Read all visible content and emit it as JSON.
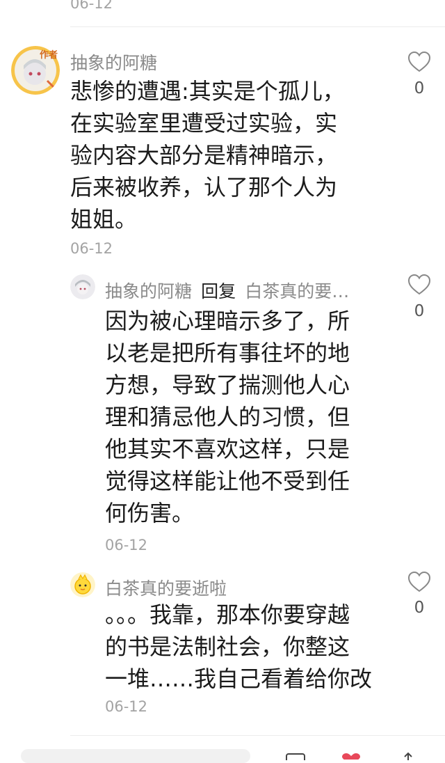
{
  "top_date": "06-12",
  "comments": [
    {
      "username": "抽象的阿糖",
      "badge": "作者",
      "text_lines": [
        "悲惨的遭遇:其实是个孤儿，",
        "在实验室里遭受过实验，实",
        "验内容大部分是精神暗示，",
        "后来被收养，认了那个人为",
        "姐姐。"
      ],
      "date": "06-12",
      "likes": "0"
    }
  ],
  "replies": [
    {
      "username": "抽象的阿糖",
      "reply_word": "回复",
      "reply_to": "白茶真的要…",
      "text_lines": [
        "因为被心理暗示多了，所",
        "以老是把所有事往坏的地",
        "方想，导致了揣测他人心",
        "理和猜忌他人的习惯，但",
        "他其实不喜欢这样，只是",
        "觉得这样能让他不受到任",
        "何伤害。"
      ],
      "date": "06-12",
      "likes": "0"
    },
    {
      "username": "白茶真的要逝啦",
      "text_lines": [
        "。。。我靠，那本你要穿越",
        "的书是法制社会，你整这",
        "一堆……我自己看着给你改"
      ],
      "date": "06-12",
      "likes": "0"
    }
  ],
  "icons": {
    "like": "heart-outline-icon",
    "bottom": [
      "comment-box-icon",
      "heart-filled-icon",
      "share-icon"
    ]
  },
  "colors": {
    "username": "#8a8a8a",
    "date": "#a3a3a3",
    "body": "#1b1b1b",
    "heart_outline": "#888888",
    "heart_filled": "#e8485a"
  }
}
